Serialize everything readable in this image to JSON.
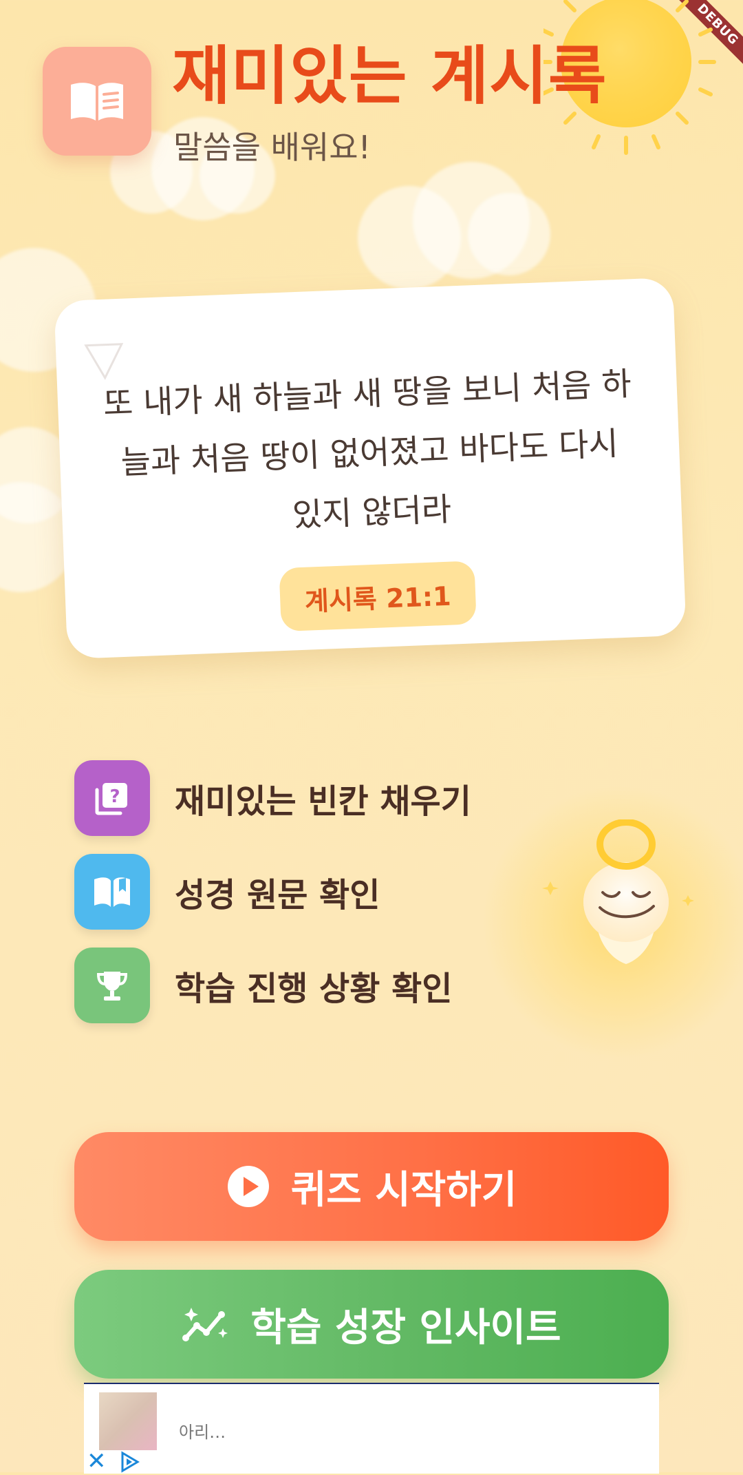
{
  "debug_banner": "DEBUG",
  "header": {
    "title": "재미있는 계시록",
    "subtitle": "말씀을 배워요!"
  },
  "verse": {
    "text": "또 내가 새 하늘과 새 땅을 보니 처음 하늘과 처음 땅이 없어졌고 바다도 다시 있지 않더라",
    "reference": "계시록 21:1"
  },
  "features": [
    {
      "label": "재미있는 빈칸 채우기",
      "icon": "quiz-card-icon",
      "color": "#b561c9"
    },
    {
      "label": "성경 원문 확인",
      "icon": "open-book-icon",
      "color": "#4fb9ee"
    },
    {
      "label": "학습 진행 상황 확인",
      "icon": "trophy-icon",
      "color": "#79c57b"
    }
  ],
  "buttons": {
    "quiz": "퀴즈 시작하기",
    "insight": "학습 성장 인사이트"
  },
  "ad": {
    "text": "아리…"
  },
  "colors": {
    "title": "#e84b1a",
    "quiz_button": "#ff6f45",
    "insight_button": "#5cb85f",
    "background": "#fde6ac"
  }
}
